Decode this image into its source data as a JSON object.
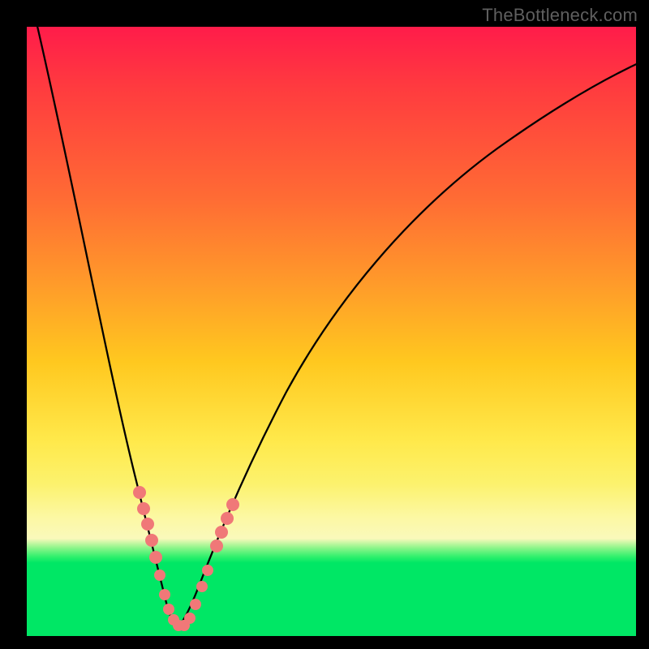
{
  "watermark": "TheBottleneck.com",
  "chart_data": {
    "type": "line",
    "title": "",
    "xlabel": "",
    "ylabel": "",
    "xlim": [
      0,
      100
    ],
    "ylim": [
      0,
      100
    ],
    "series": [
      {
        "name": "bottleneck-curve",
        "x": [
          0,
          2,
          4,
          6,
          8,
          10,
          12,
          14,
          16,
          18,
          19,
          20,
          21,
          22,
          23,
          25,
          27,
          30,
          34,
          40,
          48,
          58,
          70,
          84,
          100
        ],
        "y": [
          100,
          90,
          80,
          70,
          60,
          50,
          40,
          30,
          20,
          10,
          6,
          3,
          1,
          0.5,
          1,
          3,
          6,
          12,
          20,
          32,
          45,
          58,
          70,
          80,
          88
        ]
      }
    ],
    "markers": {
      "name": "highlighted-points",
      "x": [
        15.0,
        15.6,
        16.2,
        17.0,
        17.8,
        18.6,
        19.3,
        19.8,
        20.4,
        21.0,
        21.5,
        22.2,
        22.9,
        23.6,
        24.3,
        25.0,
        25.7,
        26.5,
        27.3
      ],
      "y": [
        25.0,
        22.0,
        19.0,
        15.5,
        12.0,
        9.0,
        6.5,
        4.5,
        3.0,
        1.8,
        1.0,
        0.5,
        1.0,
        2.0,
        3.5,
        5.5,
        8.0,
        11.0,
        14.5
      ]
    },
    "gradient_bands": [
      {
        "color": "#ff1c4a",
        "stop": 0
      },
      {
        "color": "#ffe94b",
        "stop": 68
      },
      {
        "color": "#00e765",
        "stop": 88
      }
    ]
  }
}
